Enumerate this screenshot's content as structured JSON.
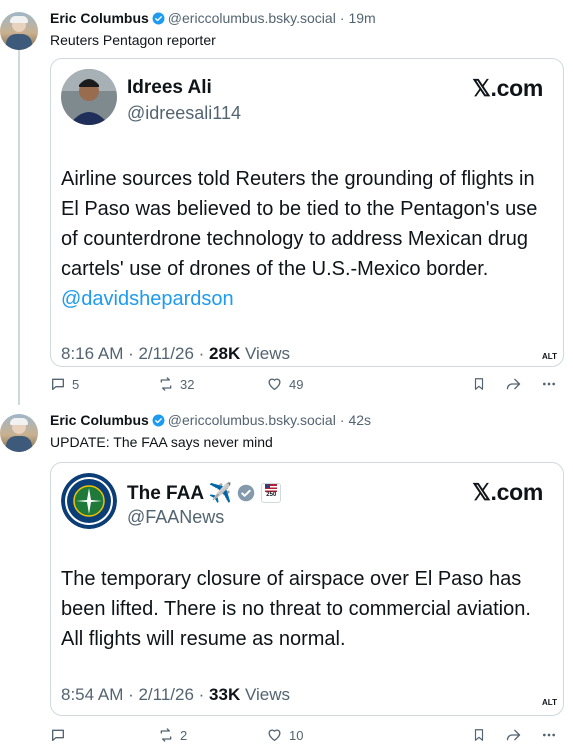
{
  "posts": [
    {
      "author": "Eric Columbus",
      "handle": "@ericcolumbus.bsky.social",
      "time": "19m",
      "text": "Reuters Pentagon reporter",
      "embed": {
        "name": "Idrees Ali",
        "handle": "@idreesali114",
        "brand": "𝕏.com",
        "text": "Airline sources told Reuters the grounding of flights in El Paso was believed to be tied to the Pentagon's use of counterdrone technology to address Mexican drug cartels' use of drones of the U.S.-Mexico border.",
        "mention": "@davidshepardson",
        "meta_time": "8:16 AM · 2/11/26 · ",
        "views_count": "28K",
        "views_label": " Views",
        "alt": "ALT"
      },
      "replies": "5",
      "reposts": "32",
      "likes": "49"
    },
    {
      "author": "Eric Columbus",
      "handle": "@ericcolumbus.bsky.social",
      "time": "42s",
      "text": "UPDATE: The FAA says never mind",
      "embed": {
        "name": "The FAA ✈️",
        "badge": "250",
        "handle": "@FAANews",
        "brand": "𝕏.com",
        "text": "The temporary closure of airspace over El Paso has been lifted. There is no threat to commercial aviation. All flights will resume as normal.",
        "meta_time": "8:54 AM · 2/11/26 · ",
        "views_count": "33K",
        "views_label": " Views",
        "alt": "ALT"
      },
      "replies": "",
      "reposts": "2",
      "likes": "10"
    }
  ],
  "colors": {
    "accent": "#1d9bf0",
    "muted": "#536471",
    "border": "#cfd9de"
  },
  "icons": [
    "verified-badge-icon",
    "reply-icon",
    "repost-icon",
    "like-icon",
    "bookmark-icon",
    "share-icon",
    "more-icon"
  ]
}
